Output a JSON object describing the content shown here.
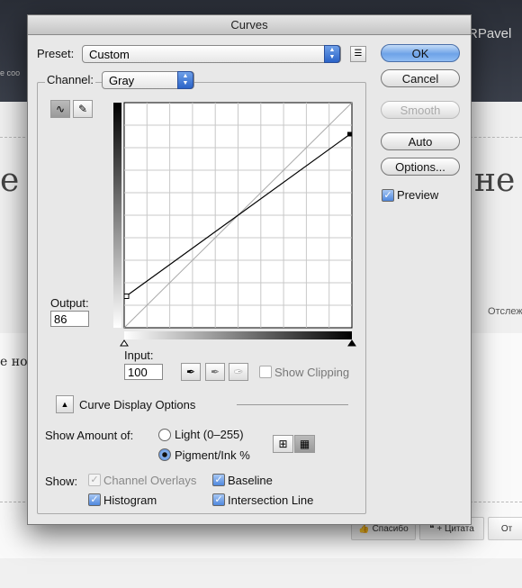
{
  "background": {
    "header_user": "RPavel",
    "header_left": "е соо",
    "big_left": "е",
    "big_right": "не",
    "side_text": "Отслеж",
    "line_text": "е нол",
    "buttons": [
      "Спасибо",
      "+ Цитата",
      "От"
    ]
  },
  "dialog": {
    "title": "Curves",
    "preset": {
      "label": "Preset:",
      "value": "Custom"
    },
    "channel": {
      "label": "Channel:",
      "value": "Gray"
    },
    "buttons": {
      "ok": "OK",
      "cancel": "Cancel",
      "smooth": "Smooth",
      "auto": "Auto",
      "options": "Options..."
    },
    "preview": {
      "label": "Preview",
      "checked": true
    },
    "output": {
      "label": "Output:",
      "value": "86"
    },
    "input": {
      "label": "Input:",
      "value": "100"
    },
    "show_clipping": {
      "label": "Show Clipping",
      "checked": false
    },
    "curve_display_options": "Curve Display Options",
    "show_amount": {
      "label": "Show Amount of:",
      "light": "Light  (0–255)",
      "pigment": "Pigment/Ink %",
      "selected": "pigment"
    },
    "show": {
      "label": "Show:",
      "channel_overlays": "Channel Overlays",
      "baseline": "Baseline",
      "histogram": "Histogram",
      "intersection_line": "Intersection Line"
    }
  },
  "curve": {
    "points": [
      [
        0,
        14
      ],
      [
        100,
        86
      ]
    ]
  }
}
